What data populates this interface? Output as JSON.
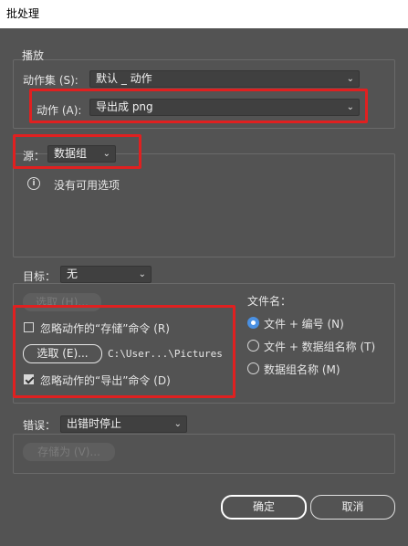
{
  "window": {
    "title": "批处理"
  },
  "play": {
    "section_label": "播放",
    "action_set_label": "动作集 (S):",
    "action_set_value": "默认 _ 动作",
    "action_label": "动作 (A):",
    "action_value": "导出成 png"
  },
  "source": {
    "label": "源：",
    "value": "数据组",
    "info_text": "没有可用选项"
  },
  "target": {
    "label": "目标：",
    "value": "无",
    "choose_disabled_label": "选取 (H)...",
    "ignore_save_label": "忽略动作的“存储”命令 (R)",
    "ignore_save_checked": false,
    "choose_label": "选取 (E)...",
    "path": "C:\\User...\\Pictures",
    "ignore_export_label": "忽略动作的“导出”命令 (D)",
    "ignore_export_checked": true,
    "filename_label": "文件名：",
    "filename_options": [
      {
        "label": "文件 + 编号 (N)",
        "checked": true
      },
      {
        "label": "文件 + 数据组名称 (T)",
        "checked": false
      },
      {
        "label": "数据组名称 (M)",
        "checked": false
      }
    ]
  },
  "errors": {
    "label": "错误：",
    "value": "出错时停止",
    "save_as_label": "存储为 (V)..."
  },
  "footer": {
    "ok_label": "确定",
    "cancel_label": "取消"
  }
}
